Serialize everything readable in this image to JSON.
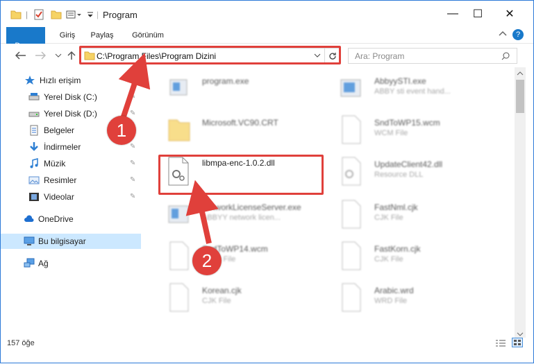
{
  "window": {
    "title": "Program",
    "controls": {
      "minimize": "—",
      "maximize": "☐",
      "close": "✕"
    }
  },
  "ribbon": {
    "tabs": [
      "Dosya",
      "Giriş",
      "Paylaş",
      "Görünüm"
    ]
  },
  "address": {
    "path": "C:\\Program Files\\Program Dizini",
    "search_placeholder": "Ara: Program"
  },
  "sidebar": {
    "items": [
      {
        "label": "Hızlı erişim",
        "icon": "star-icon"
      },
      {
        "label": "Yerel Disk (C:)",
        "icon": "drive-icon"
      },
      {
        "label": "Yerel Disk (D:)",
        "icon": "drive-icon"
      },
      {
        "label": "Belgeler",
        "icon": "documents-icon"
      },
      {
        "label": "İndirmeler",
        "icon": "download-icon"
      },
      {
        "label": "Müzik",
        "icon": "music-icon"
      },
      {
        "label": "Resimler",
        "icon": "pictures-icon"
      },
      {
        "label": "Videolar",
        "icon": "video-icon"
      },
      {
        "label": "OneDrive",
        "icon": "cloud-icon"
      },
      {
        "label": "Bu bilgisayar",
        "icon": "computer-icon"
      },
      {
        "label": "Ağ",
        "icon": "network-icon"
      }
    ]
  },
  "files": {
    "left": [
      {
        "name": "program.exe",
        "type": ""
      },
      {
        "name": "Microsoft.VC90.CRT",
        "type": ""
      },
      {
        "name": "libmpa-enc-1.0.2.dll",
        "type": ""
      },
      {
        "name": "NetworkLicenseServer.exe",
        "type": "ABBYY network licen..."
      },
      {
        "name": "SndToWP14.wcm",
        "type": "WCM File"
      },
      {
        "name": "Korean.cjk",
        "type": "CJK File"
      }
    ],
    "right": [
      {
        "name": "AbbyySTI.exe",
        "type": "ABBY sti event hand..."
      },
      {
        "name": "SndToWP15.wcm",
        "type": "WCM File"
      },
      {
        "name": "UpdateClient42.dll",
        "type": "Resource DLL"
      },
      {
        "name": "FastNml.cjk",
        "type": "CJK File"
      },
      {
        "name": "FastKorn.cjk",
        "type": "CJK File"
      },
      {
        "name": "Arabic.wrd",
        "type": "WRD File"
      }
    ]
  },
  "status": {
    "count": "157 öğe"
  },
  "annotations": {
    "marker1": "1",
    "marker2": "2"
  },
  "colors": {
    "accent": "#1979ca",
    "highlight": "#e0403b",
    "selected": "#cce8ff"
  }
}
